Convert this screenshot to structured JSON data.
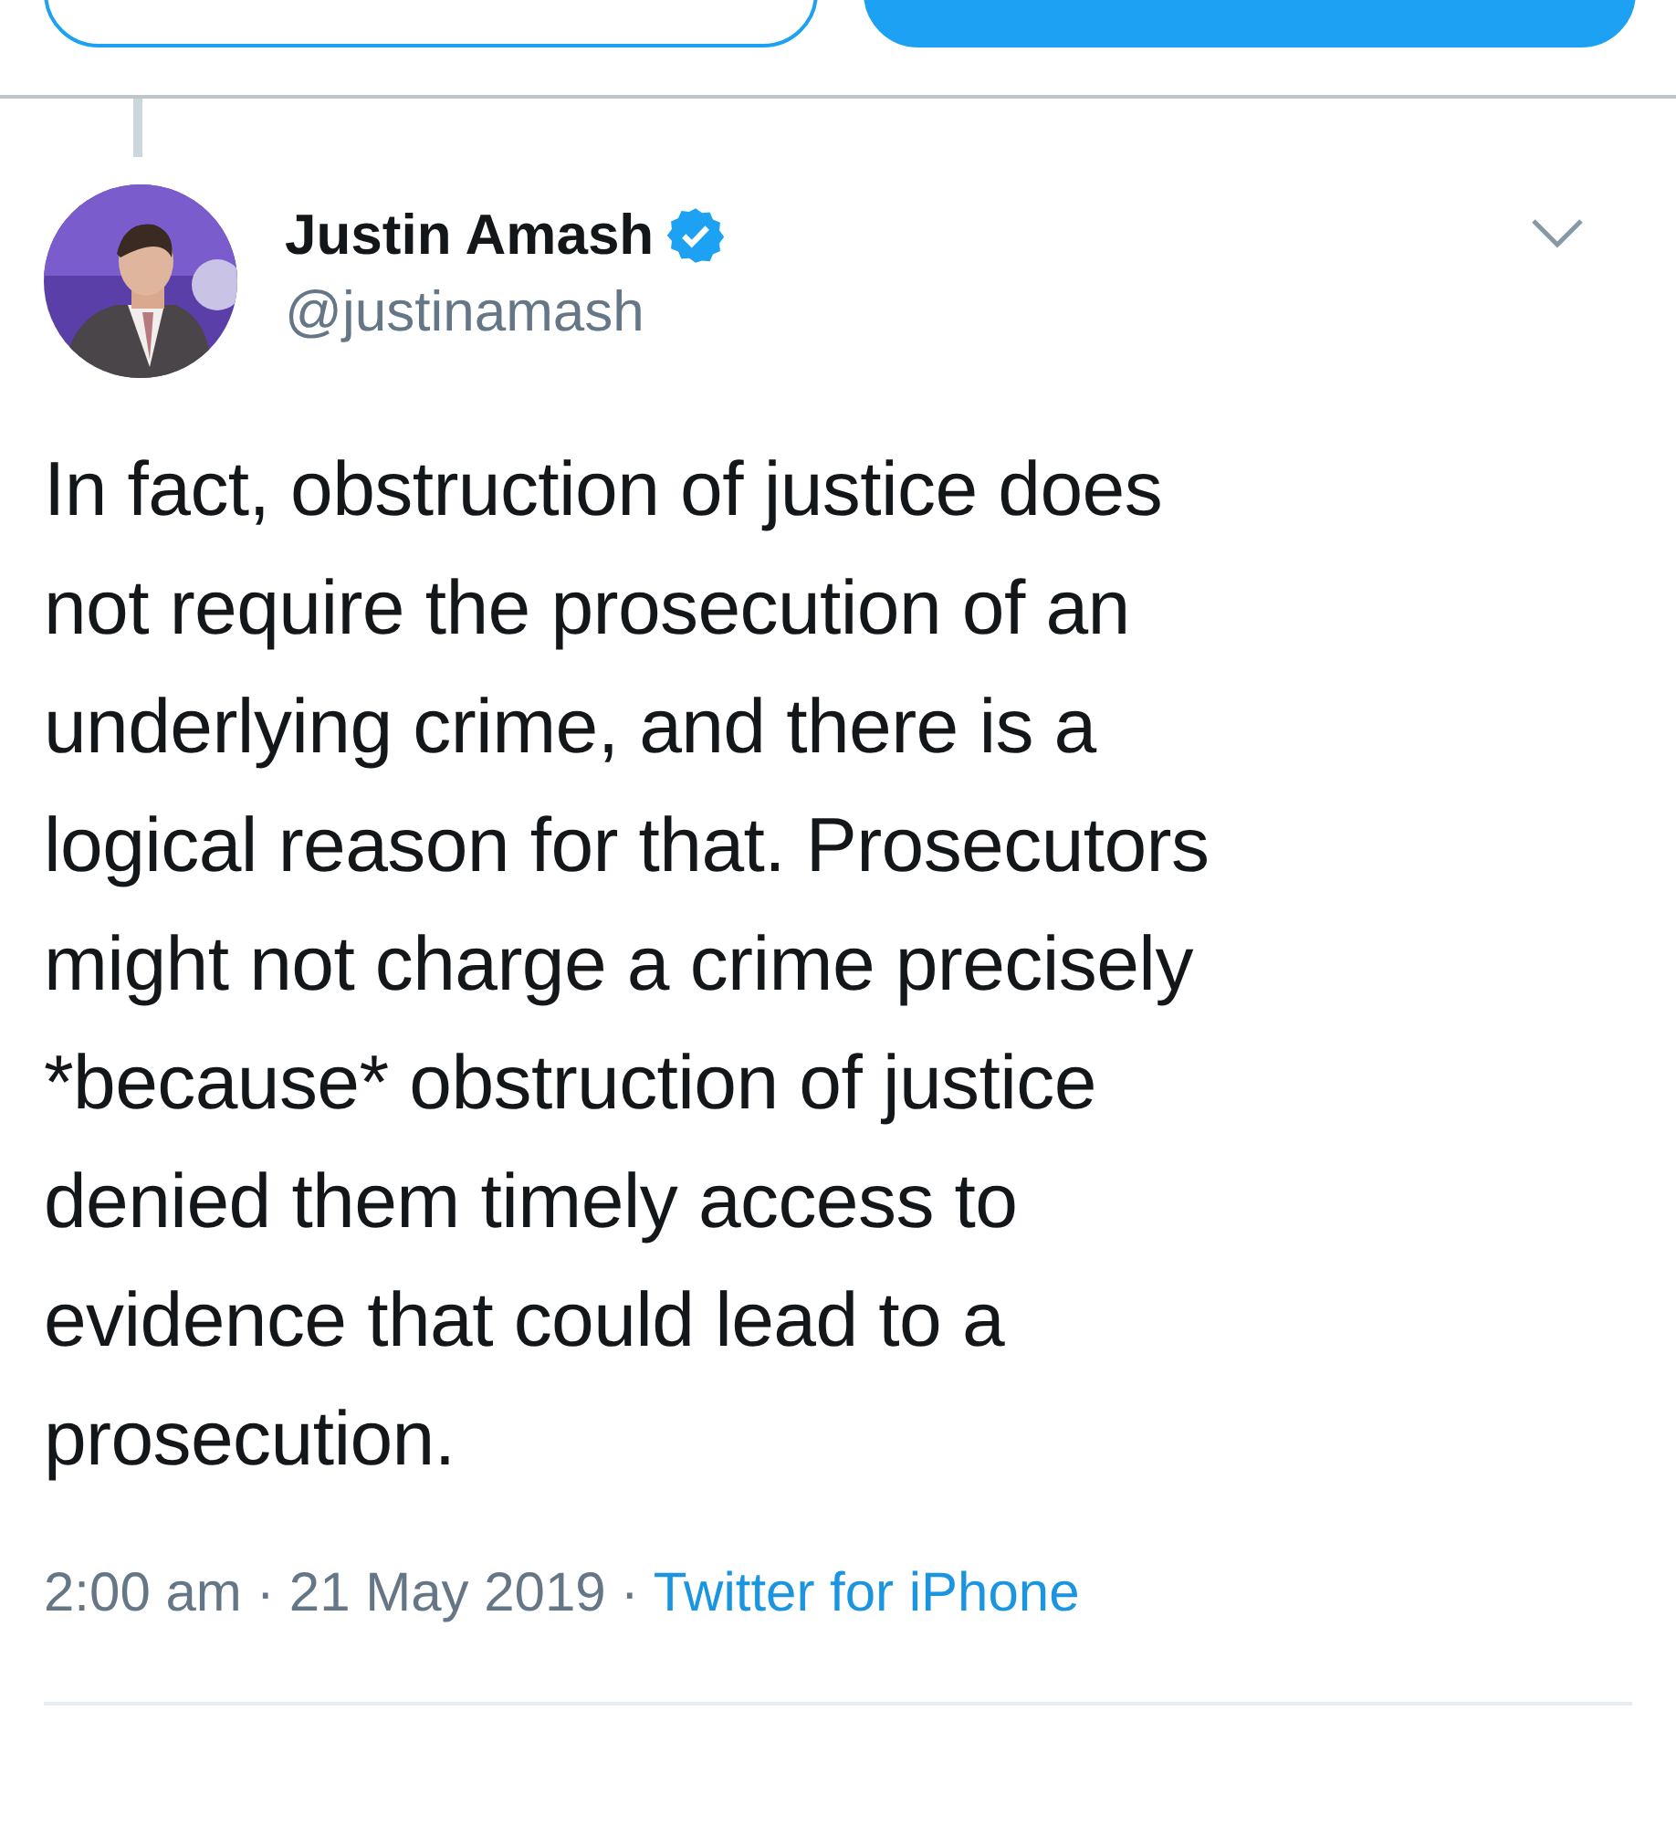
{
  "top_buttons": [
    {
      "kind": "outline"
    },
    {
      "kind": "filled"
    }
  ],
  "tweet": {
    "name": "Justin Amash",
    "verified": true,
    "handle": "@justinamash",
    "text": "In fact, obstruction of justice does\nnot require the prosecution of an\nunderlying crime, and there is a\nlogical reason for that. Prosecutors\nmight not charge a crime precisely\n*because* obstruction of justice\ndenied them timely access to\nevidence that could lead to a\nprosecution.",
    "time": "2:00 am",
    "separator_1": "·",
    "date": "21 May 2019",
    "separator_2": "·",
    "source": "Twitter for iPhone"
  }
}
